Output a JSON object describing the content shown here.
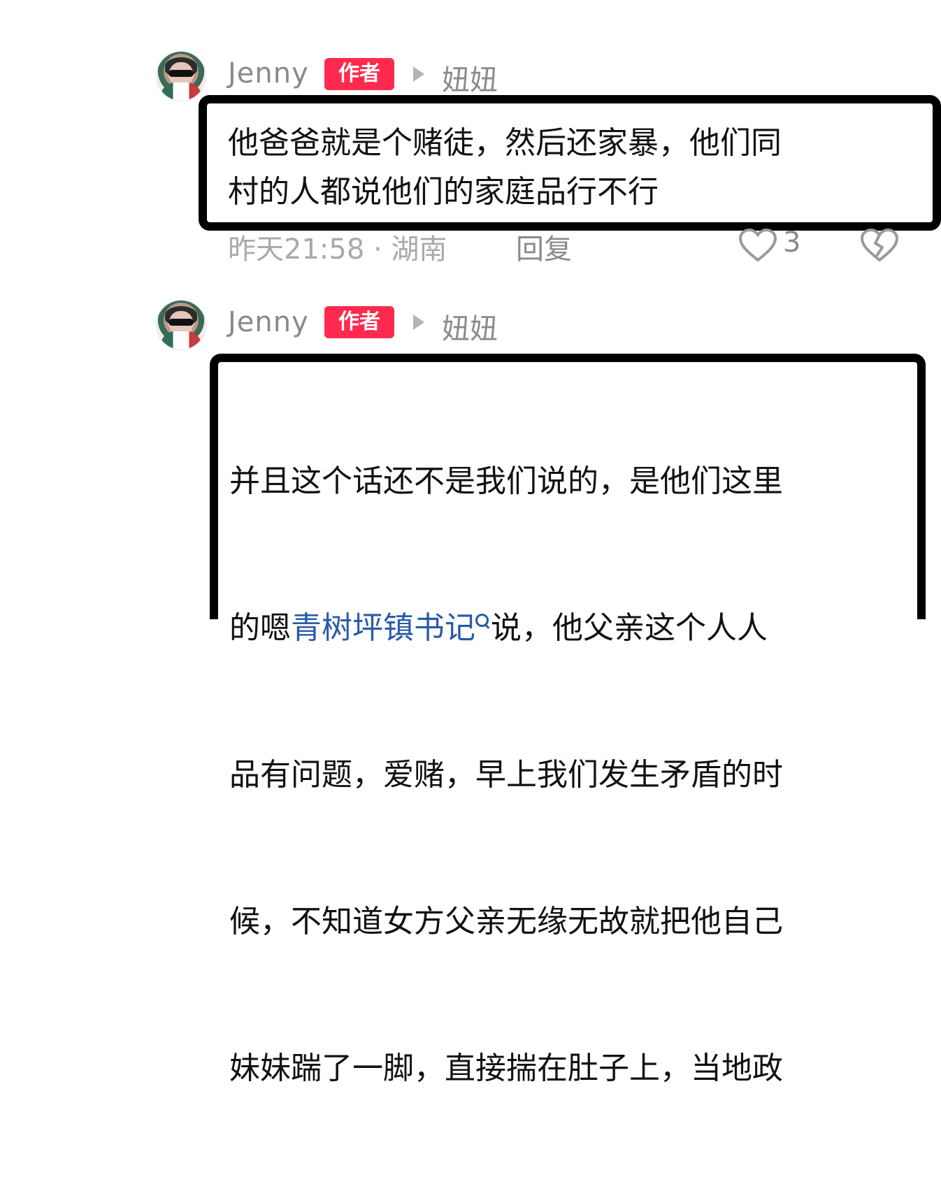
{
  "comments": [
    {
      "username": "Jenny",
      "badge": "作者",
      "reply_to": "妞妞",
      "text": "他爸爸就是个赌徒，然后还家暴，他们同\n村的人都说他们的家庭品行不行",
      "meta": "昨天21:58 · 湖南",
      "reply_label": "回复",
      "likes": "3"
    },
    {
      "username": "Jenny",
      "badge": "作者",
      "reply_to": "妞妞",
      "text_lines": [
        "并且这个话还不是我们说的，是他们这里",
        "的嗯",
        "说，他父亲这个人人",
        "品有问题，爱赌，早上我们发生矛盾的时",
        "候，不知道女方父亲无缘无故就把他自己",
        "妹妹踹了一脚，直接揣在肚子上，当地政"
      ],
      "link_text": "青树坪镇书记"
    }
  ],
  "icons": {
    "reply_arrow": "play-arrow-icon",
    "search": "search-icon",
    "like": "heart-icon",
    "dislike": "broken-heart-icon"
  },
  "colors": {
    "badge": "#ff2a4e",
    "link": "#2a5aa8",
    "muted": "#8a8a8a"
  }
}
